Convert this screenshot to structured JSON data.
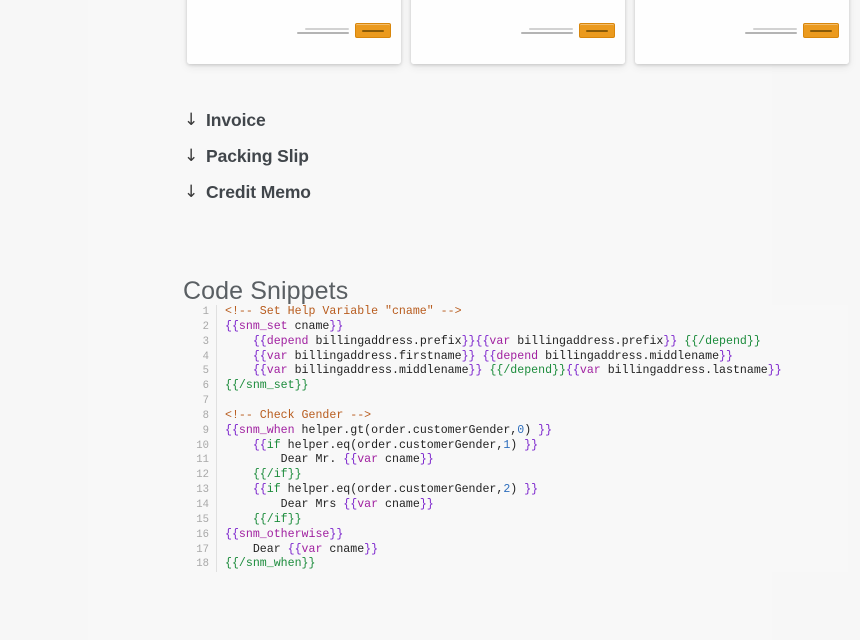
{
  "theme": {
    "page_background": "#f7f7f7",
    "content_background": "#f8f8f8",
    "accent_orange": "#eb9a1e",
    "heading_color": "#5a5f63",
    "code_comment": "#b85c1e",
    "code_brace": "#7d26cd",
    "code_tag": "#a020a0",
    "code_close": "#1c8c3c",
    "code_number": "#2f6fbd"
  },
  "template_cards": [
    {
      "name": "template-card-invoice",
      "action_icon": "orange-button"
    },
    {
      "name": "template-card-packing-slip",
      "action_icon": "orange-button"
    },
    {
      "name": "template-card-credit-memo",
      "action_icon": "orange-button"
    }
  ],
  "downloads": {
    "arrow_icon": "↓",
    "items": [
      {
        "label": "Invoice"
      },
      {
        "label": "Packing Slip"
      },
      {
        "label": "Credit Memo"
      }
    ]
  },
  "section": {
    "heading": "Code Snippets"
  },
  "code": {
    "language": "smarty-template",
    "line_numbers": [
      "1",
      "2",
      "3",
      "4",
      "5",
      "6",
      "7",
      "8",
      "9",
      "10",
      "11",
      "12",
      "13",
      "14",
      "15",
      "16",
      "17",
      "18"
    ],
    "lines": [
      "<!-- Set Help Variable \"cname\" -->",
      "{{snm_set cname}}",
      "    {{depend billingaddress.prefix}}{{var billingaddress.prefix}} {{/depend}}",
      "    {{var billingaddress.firstname}} {{depend billingaddress.middlename}}",
      "    {{var billingaddress.middlename}} {{/depend}}{{var billingaddress.lastname}}",
      "{{/snm_set}}",
      "",
      "<!-- Check Gender -->",
      "{{snm_when helper.gt(order.customerGender,0) }}",
      "    {{if helper.eq(order.customerGender,1) }}",
      "        Dear Mr. {{var cname}}",
      "    {{/if}}",
      "    {{if helper.eq(order.customerGender,2) }}",
      "        Dear Mrs {{var cname}}",
      "    {{/if}}",
      "{{snm_otherwise}}",
      "    Dear {{var cname}}",
      "{{/snm_when}}"
    ],
    "tokens": [
      [
        {
          "t": "<!-- Set Help Variable \"cname\" -->",
          "c": "tok-comment"
        }
      ],
      [
        {
          "t": "{{",
          "c": "tok-brace"
        },
        {
          "t": "snm_set",
          "c": "tok-tag"
        },
        {
          "t": " cname",
          "c": "tok-plain"
        },
        {
          "t": "}}",
          "c": "tok-brace"
        }
      ],
      [
        {
          "t": "    ",
          "c": "tok-plain"
        },
        {
          "t": "{{",
          "c": "tok-brace"
        },
        {
          "t": "depend",
          "c": "tok-tag"
        },
        {
          "t": " billingaddress.prefix",
          "c": "tok-plain"
        },
        {
          "t": "}}",
          "c": "tok-brace"
        },
        {
          "t": "{{",
          "c": "tok-brace"
        },
        {
          "t": "var",
          "c": "tok-tag"
        },
        {
          "t": " billingaddress.prefix",
          "c": "tok-plain"
        },
        {
          "t": "}}",
          "c": "tok-brace"
        },
        {
          "t": " ",
          "c": "tok-plain"
        },
        {
          "t": "{{/depend}}",
          "c": "tok-close"
        }
      ],
      [
        {
          "t": "    ",
          "c": "tok-plain"
        },
        {
          "t": "{{",
          "c": "tok-brace"
        },
        {
          "t": "var",
          "c": "tok-tag"
        },
        {
          "t": " billingaddress.firstname",
          "c": "tok-plain"
        },
        {
          "t": "}}",
          "c": "tok-brace"
        },
        {
          "t": " ",
          "c": "tok-plain"
        },
        {
          "t": "{{",
          "c": "tok-brace"
        },
        {
          "t": "depend",
          "c": "tok-tag"
        },
        {
          "t": " billingaddress.middlename",
          "c": "tok-plain"
        },
        {
          "t": "}}",
          "c": "tok-brace"
        }
      ],
      [
        {
          "t": "    ",
          "c": "tok-plain"
        },
        {
          "t": "{{",
          "c": "tok-brace"
        },
        {
          "t": "var",
          "c": "tok-tag"
        },
        {
          "t": " billingaddress.middlename",
          "c": "tok-plain"
        },
        {
          "t": "}}",
          "c": "tok-brace"
        },
        {
          "t": " ",
          "c": "tok-plain"
        },
        {
          "t": "{{/depend}}",
          "c": "tok-close"
        },
        {
          "t": "{{",
          "c": "tok-brace"
        },
        {
          "t": "var",
          "c": "tok-tag"
        },
        {
          "t": " billingaddress.lastname",
          "c": "tok-plain"
        },
        {
          "t": "}}",
          "c": "tok-brace"
        }
      ],
      [
        {
          "t": "{{/snm_set}}",
          "c": "tok-close"
        }
      ],
      [
        {
          "t": "",
          "c": "tok-plain"
        }
      ],
      [
        {
          "t": "<!-- Check Gender -->",
          "c": "tok-comment"
        }
      ],
      [
        {
          "t": "{{",
          "c": "tok-brace"
        },
        {
          "t": "snm_when",
          "c": "tok-tag"
        },
        {
          "t": " helper.gt(order.customerGender,",
          "c": "tok-plain"
        },
        {
          "t": "0",
          "c": "tok-number"
        },
        {
          "t": ") ",
          "c": "tok-plain"
        },
        {
          "t": "}}",
          "c": "tok-brace"
        }
      ],
      [
        {
          "t": "    ",
          "c": "tok-plain"
        },
        {
          "t": "{{",
          "c": "tok-brace"
        },
        {
          "t": "if",
          "c": "tok-close"
        },
        {
          "t": " helper.eq(order.customerGender,",
          "c": "tok-plain"
        },
        {
          "t": "1",
          "c": "tok-number"
        },
        {
          "t": ") ",
          "c": "tok-plain"
        },
        {
          "t": "}}",
          "c": "tok-brace"
        }
      ],
      [
        {
          "t": "        Dear Mr. ",
          "c": "tok-plain"
        },
        {
          "t": "{{",
          "c": "tok-brace"
        },
        {
          "t": "var",
          "c": "tok-tag"
        },
        {
          "t": " cname",
          "c": "tok-plain"
        },
        {
          "t": "}}",
          "c": "tok-brace"
        }
      ],
      [
        {
          "t": "    ",
          "c": "tok-plain"
        },
        {
          "t": "{{/if}}",
          "c": "tok-close"
        }
      ],
      [
        {
          "t": "    ",
          "c": "tok-plain"
        },
        {
          "t": "{{",
          "c": "tok-brace"
        },
        {
          "t": "if",
          "c": "tok-close"
        },
        {
          "t": " helper.eq(order.customerGender,",
          "c": "tok-plain"
        },
        {
          "t": "2",
          "c": "tok-number"
        },
        {
          "t": ") ",
          "c": "tok-plain"
        },
        {
          "t": "}}",
          "c": "tok-brace"
        }
      ],
      [
        {
          "t": "        Dear Mrs ",
          "c": "tok-plain"
        },
        {
          "t": "{{",
          "c": "tok-brace"
        },
        {
          "t": "var",
          "c": "tok-tag"
        },
        {
          "t": " cname",
          "c": "tok-plain"
        },
        {
          "t": "}}",
          "c": "tok-brace"
        }
      ],
      [
        {
          "t": "    ",
          "c": "tok-plain"
        },
        {
          "t": "{{/if}}",
          "c": "tok-close"
        }
      ],
      [
        {
          "t": "{{",
          "c": "tok-brace"
        },
        {
          "t": "snm_otherwise",
          "c": "tok-tag"
        },
        {
          "t": "}}",
          "c": "tok-brace"
        }
      ],
      [
        {
          "t": "    Dear ",
          "c": "tok-plain"
        },
        {
          "t": "{{",
          "c": "tok-brace"
        },
        {
          "t": "var",
          "c": "tok-tag"
        },
        {
          "t": " cname",
          "c": "tok-plain"
        },
        {
          "t": "}}",
          "c": "tok-brace"
        }
      ],
      [
        {
          "t": "{{/snm_when}}",
          "c": "tok-close"
        }
      ]
    ]
  }
}
